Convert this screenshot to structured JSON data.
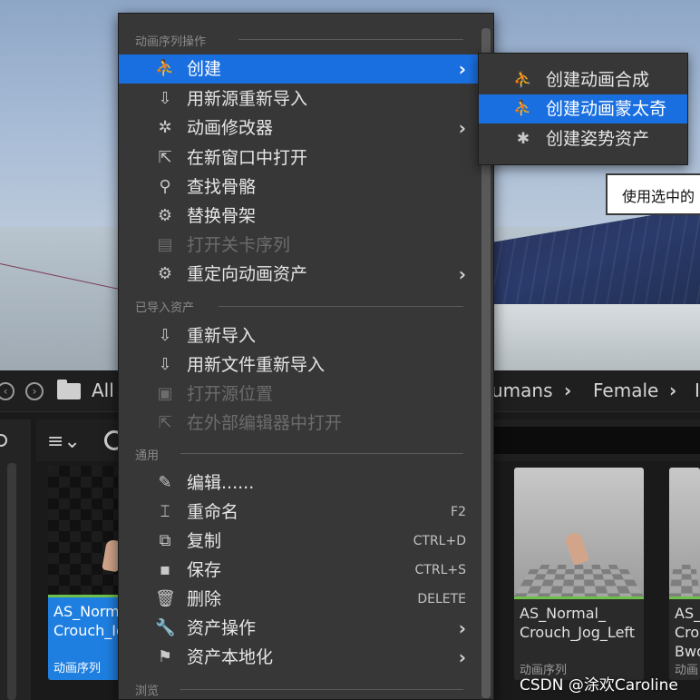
{
  "breadcrumb": {
    "all": "All",
    "humans": "umans",
    "female": "Female",
    "next": "I"
  },
  "menu": {
    "section_anim_ops": "动画序列操作",
    "section_imported": "已导入资产",
    "section_common": "通用",
    "section_browse": "浏览",
    "items": [
      {
        "label": "创建",
        "icon": "create-anim-icon",
        "arrow": "›"
      },
      {
        "label": "用新源重新导入",
        "icon": "reimport-icon"
      },
      {
        "label": "动画修改器",
        "icon": "modifier-icon",
        "arrow": "›"
      },
      {
        "label": "在新窗口中打开",
        "icon": "open-window-icon"
      },
      {
        "label": "查找骨骼",
        "icon": "find-skeleton-icon"
      },
      {
        "label": "替换骨架",
        "icon": "replace-skeleton-icon"
      },
      {
        "label": "打开关卡序列",
        "icon": "level-sequence-icon",
        "disabled": true
      },
      {
        "label": "重定向动画资产",
        "icon": "retarget-icon",
        "arrow": "›"
      },
      {
        "label": "重新导入",
        "icon": "reimport-icon"
      },
      {
        "label": "用新文件重新导入",
        "icon": "reimport-file-icon"
      },
      {
        "label": "打开源位置",
        "icon": "source-location-icon",
        "disabled": true
      },
      {
        "label": "在外部编辑器中打开",
        "icon": "external-editor-icon",
        "disabled": true
      },
      {
        "label": "编辑......",
        "icon": "edit-icon"
      },
      {
        "label": "重命名",
        "icon": "rename-icon",
        "shortcut": "F2"
      },
      {
        "label": "复制",
        "icon": "duplicate-icon",
        "shortcut": "CTRL+D"
      },
      {
        "label": "保存",
        "icon": "save-icon",
        "shortcut": "CTRL+S"
      },
      {
        "label": "删除",
        "icon": "delete-icon",
        "shortcut": "DELETE"
      },
      {
        "label": "资产操作",
        "icon": "wrench-icon",
        "arrow": "›"
      },
      {
        "label": "资产本地化",
        "icon": "flag-icon",
        "arrow": "›"
      }
    ]
  },
  "submenu": {
    "items": [
      {
        "label": "创建动画合成",
        "icon": "anim-composite-icon"
      },
      {
        "label": "创建动画蒙太奇",
        "icon": "anim-montage-icon"
      },
      {
        "label": "创建姿势资产",
        "icon": "pose-asset-icon"
      }
    ]
  },
  "tooltip": {
    "text": "使用选中的"
  },
  "assets": [
    {
      "name": "AS_Norm\nCrouch_Id",
      "type": "动画序列"
    },
    {
      "name": "AS_Normal_\nCrouch_Jog_Left",
      "type": "动画序列"
    },
    {
      "name": "AS_\nCrou\nBwd",
      "type": "动画"
    }
  ],
  "watermark": "CSDN @涂欢Caroline",
  "colors": {
    "highlight": "#1a6fe0",
    "menu_bg": "#373737",
    "selected_tile": "#1f7fe0"
  }
}
